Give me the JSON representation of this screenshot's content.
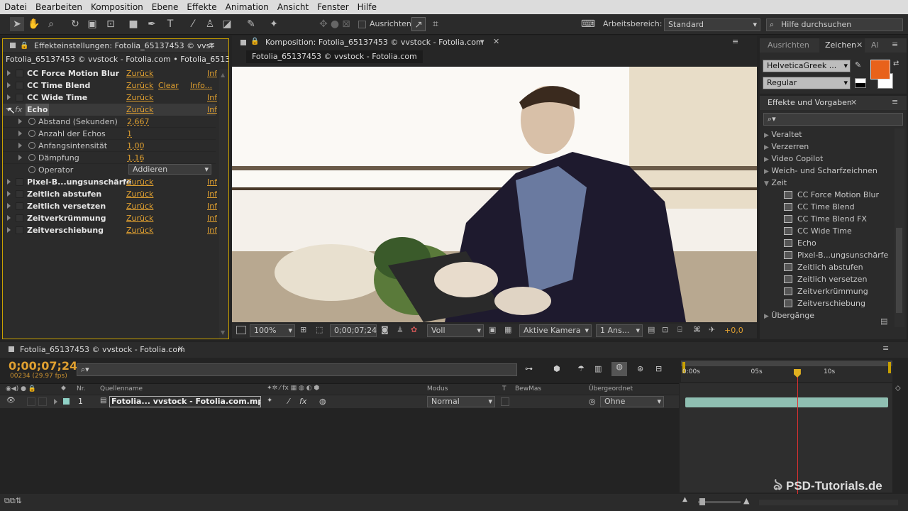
{
  "menu": [
    "Datei",
    "Bearbeiten",
    "Komposition",
    "Ebene",
    "Effekte",
    "Animation",
    "Ansicht",
    "Fenster",
    "Hilfe"
  ],
  "toolbar": {
    "align_label": "Ausrichten",
    "workspace_label": "Arbeitsbereich:",
    "workspace_value": "Standard",
    "help_placeholder": "Hilfe durchsuchen"
  },
  "effects_panel": {
    "tab": "Effekteinstellungen: Fotolia_65137453 © vvst",
    "header": "Fotolia_65137453 © vvstock - Fotolia.com • Fotolia_65137453",
    "effects_top": [
      {
        "name": "CC Force Motion Blur",
        "reset": "Zurück",
        "extra": "",
        "info": "Inf"
      },
      {
        "name": "CC Time Blend",
        "reset": "Zurück",
        "extra": "Clear",
        "info": "Info..."
      },
      {
        "name": "CC Wide Time",
        "reset": "Zurück",
        "extra": "",
        "info": "Inf"
      }
    ],
    "echo": {
      "name": "Echo",
      "reset": "Zurück",
      "info": "Inf"
    },
    "echo_params": [
      {
        "name": "Abstand (Sekunden)",
        "value": "2,667"
      },
      {
        "name": "Anzahl der Echos",
        "value": "1"
      },
      {
        "name": "Anfangsintensität",
        "value": "1,00"
      },
      {
        "name": "Dämpfung",
        "value": "1,16"
      }
    ],
    "operator": {
      "name": "Operator",
      "value": "Addieren"
    },
    "effects_bottom": [
      {
        "name": "Pixel-B...ungsunschärfe",
        "reset": "Zurück",
        "info": "Inf"
      },
      {
        "name": "Zeitlich abstufen",
        "reset": "Zurück",
        "info": "Inf"
      },
      {
        "name": "Zeitlich versetzen",
        "reset": "Zurück",
        "info": "Inf"
      },
      {
        "name": "Zeitverkrümmung",
        "reset": "Zurück",
        "info": "Inf"
      },
      {
        "name": "Zeitverschiebung",
        "reset": "Zurück",
        "info": "Inf"
      }
    ]
  },
  "comp_panel": {
    "tab": "Komposition: Fotolia_65137453 © vvstock - Fotolia.com",
    "subtab": "Fotolia_65137453 © vvstock - Fotolia.com",
    "zoom": "100%",
    "timecode": "0;00;07;24",
    "resolution": "Voll",
    "camera": "Aktive Kamera",
    "views": "1 Ans...",
    "exposure": "+0,0"
  },
  "char_panel": {
    "tabs": [
      "Ausrichten",
      "Zeichen",
      "Al"
    ],
    "font": "HelveticaGreek ...",
    "style": "Regular",
    "fill_color": "#e8621a"
  },
  "presets_panel": {
    "tab": "Effekte und Vorgaben",
    "categories": [
      "Veraltet",
      "Verzerren",
      "Video Copilot",
      "Weich- und Scharfzeichnen",
      "Zeit"
    ],
    "time_effects": [
      "CC Force Motion Blur",
      "CC Time Blend",
      "CC Time Blend FX",
      "CC Wide Time",
      "Echo",
      "Pixel-B...ungsunschärfe",
      "Zeitlich abstufen",
      "Zeitlich versetzen",
      "Zeitverkrümmung",
      "Zeitverschiebung"
    ],
    "after": "Übergänge"
  },
  "timeline": {
    "tab": "Fotolia_65137453 © vvstock - Fotolia.com",
    "timecode": "0;00;07;24",
    "fps": "00234 (29.97 fps)",
    "columns": {
      "nr": "Nr.",
      "source": "Quellenname",
      "mode": "Modus",
      "t": "T",
      "trkmat": "BewMas",
      "parent": "Übergeordnet"
    },
    "layer": {
      "nr": "1",
      "name": "Fotolia... vvstock - Fotolia.com.mp4",
      "mode": "Normal",
      "parent": "Ohne"
    },
    "ruler": [
      "0:00s",
      "05s",
      "10s"
    ],
    "playhead_seconds": 7.8
  },
  "watermark": "PSD-Tutorials.de"
}
